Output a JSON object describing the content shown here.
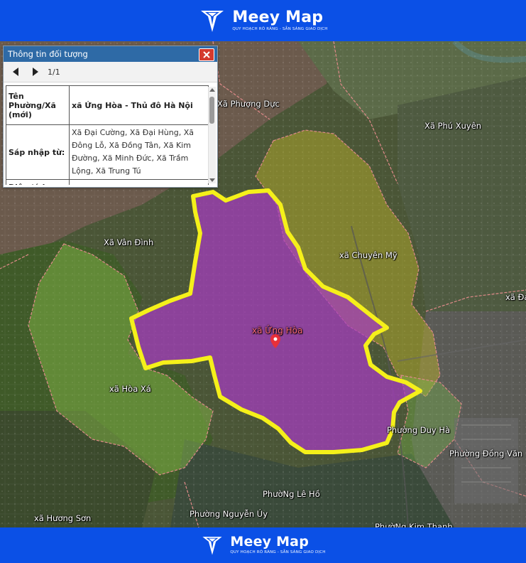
{
  "brand": {
    "name": "Meey Map",
    "tagline": "QUY HOẠCH RÕ RÀNG - SẴN SÀNG GIAO DỊCH"
  },
  "panel": {
    "title": "Thông tin đối tượng",
    "pager": "1/1",
    "rows": [
      {
        "key": "Tên Phường/Xã (mới)",
        "value": "xã Ứng Hòa - Thủ đô Hà Nội"
      },
      {
        "key": "Sáp nhập từ:",
        "value": "Xã Đại Cường, Xã Đại Hùng, Xã Đông Lỗ, Xã Đồng Tân, Xã Kim Đường, Xã Minh Đức, Xã Trầm Lộng, Xã Trung Tú"
      },
      {
        "key": "Diện tích",
        "value": ""
      }
    ]
  },
  "map": {
    "selected_label": "xã Ứng Hòa",
    "highlight_color": "#b43cc8",
    "border_color": "#f5f01a",
    "labels": {
      "phuong_duc": "Xã Phượng Dực",
      "phu_xuyen": "Xã Phú Xuyên",
      "van_dinh": "Xã Vân Đình",
      "chuyen_my": "xã Chuyên Mỹ",
      "dai_cut": "xã Đa",
      "hoa_xa": "xã Hòa Xá",
      "duy_ha": "Phường Duy Hà",
      "dong_van": "Phường Đồng Văn",
      "le_ho": "PhườNg Lê Hồ",
      "nguyen_uy": "Phường Nguyễn Úy",
      "huong_son": "xã Hương Sơn",
      "kim_thanh": "PhườNg Kim Thanh"
    }
  }
}
